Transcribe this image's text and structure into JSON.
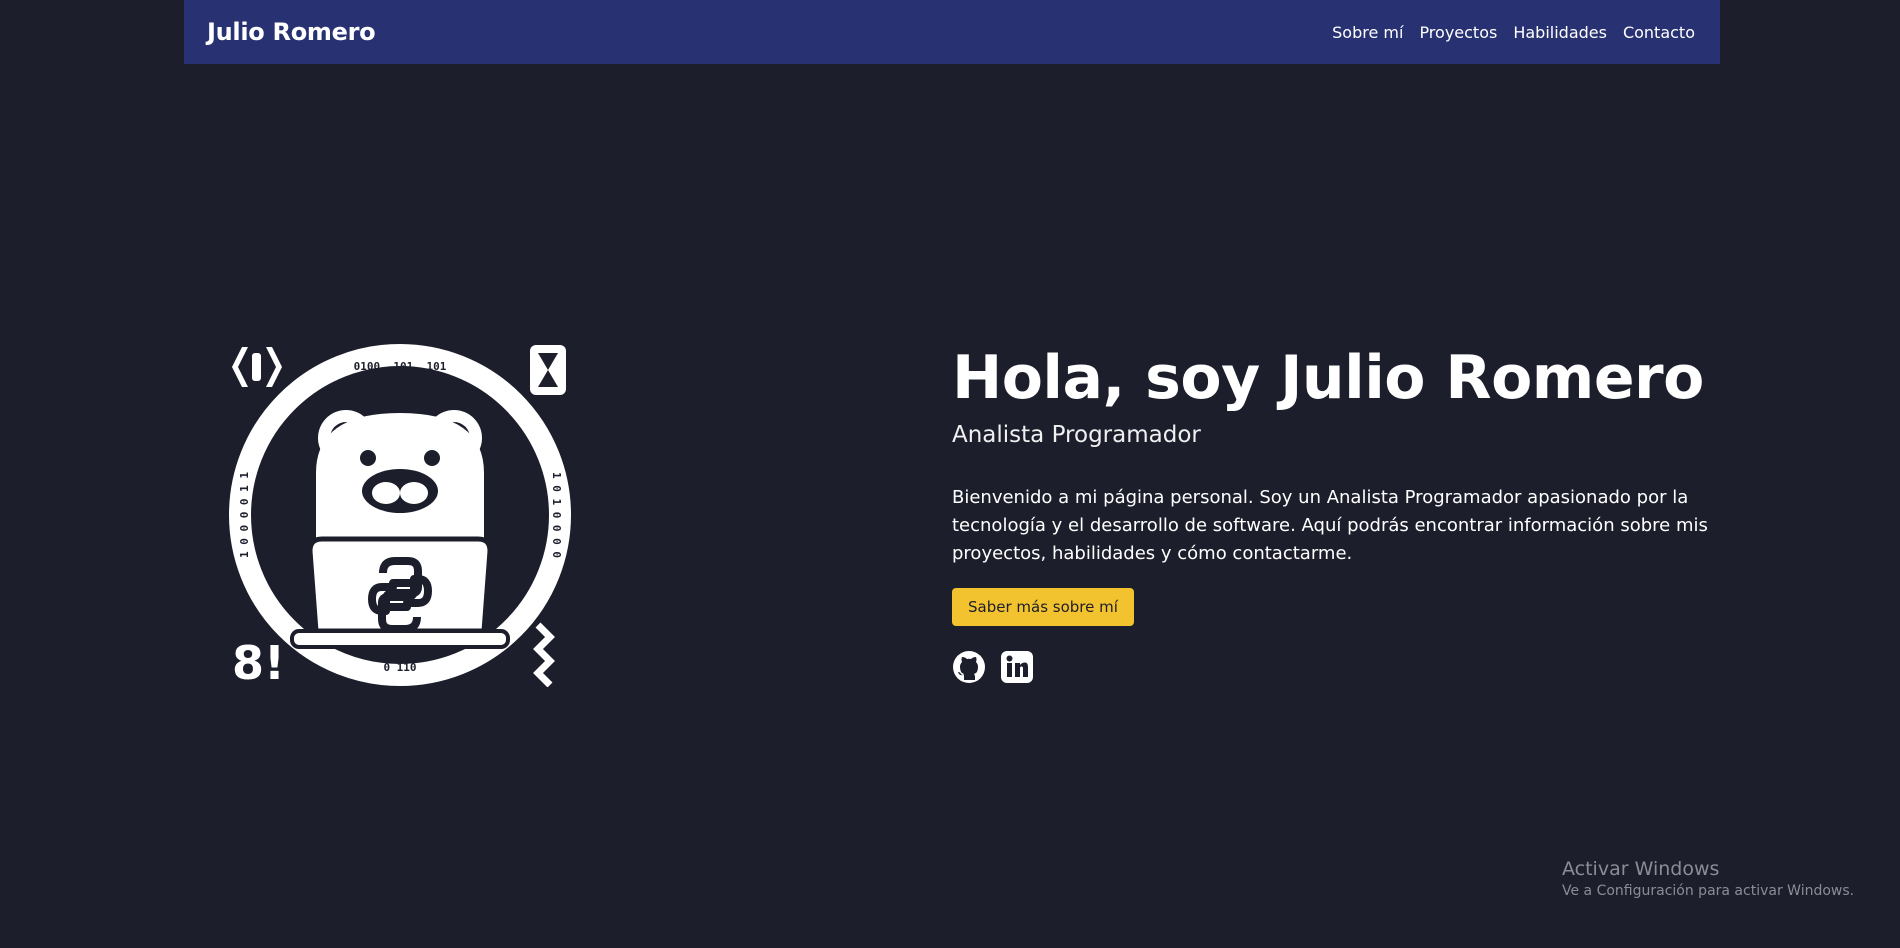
{
  "navbar": {
    "brand": "Julio Romero",
    "links": [
      {
        "label": "Sobre mí"
      },
      {
        "label": "Proyectos"
      },
      {
        "label": "Habilidades"
      },
      {
        "label": "Contacto"
      }
    ]
  },
  "hero": {
    "title": "Hola, soy Julio Romero",
    "subtitle": "Analista Programador",
    "description": "Bienvenido a mi página personal. Soy un Analista Programador apasionado por la tecnología y el desarrollo de software. Aquí podrás encontrar información sobre mis proyectos, habilidades y cómo contactarme.",
    "cta_label": "Saber más sobre mí",
    "image": {
      "ring_text_top": "0100, 101, 101",
      "ring_text_left": "1 0 0 0 0 1 1",
      "ring_text_right": "1 0 1 0 0 0 0",
      "ring_text_bottom": "0 110",
      "corner_text": "8!"
    },
    "socials": [
      {
        "icon": "github-icon"
      },
      {
        "icon": "linkedin-icon"
      }
    ]
  },
  "watermark": {
    "title": "Activar Windows",
    "subtitle": "Ve a Configuración para activar Windows."
  },
  "colors": {
    "background": "#1c1f2b",
    "navbar": "#283272",
    "accent": "#f3c22f"
  }
}
